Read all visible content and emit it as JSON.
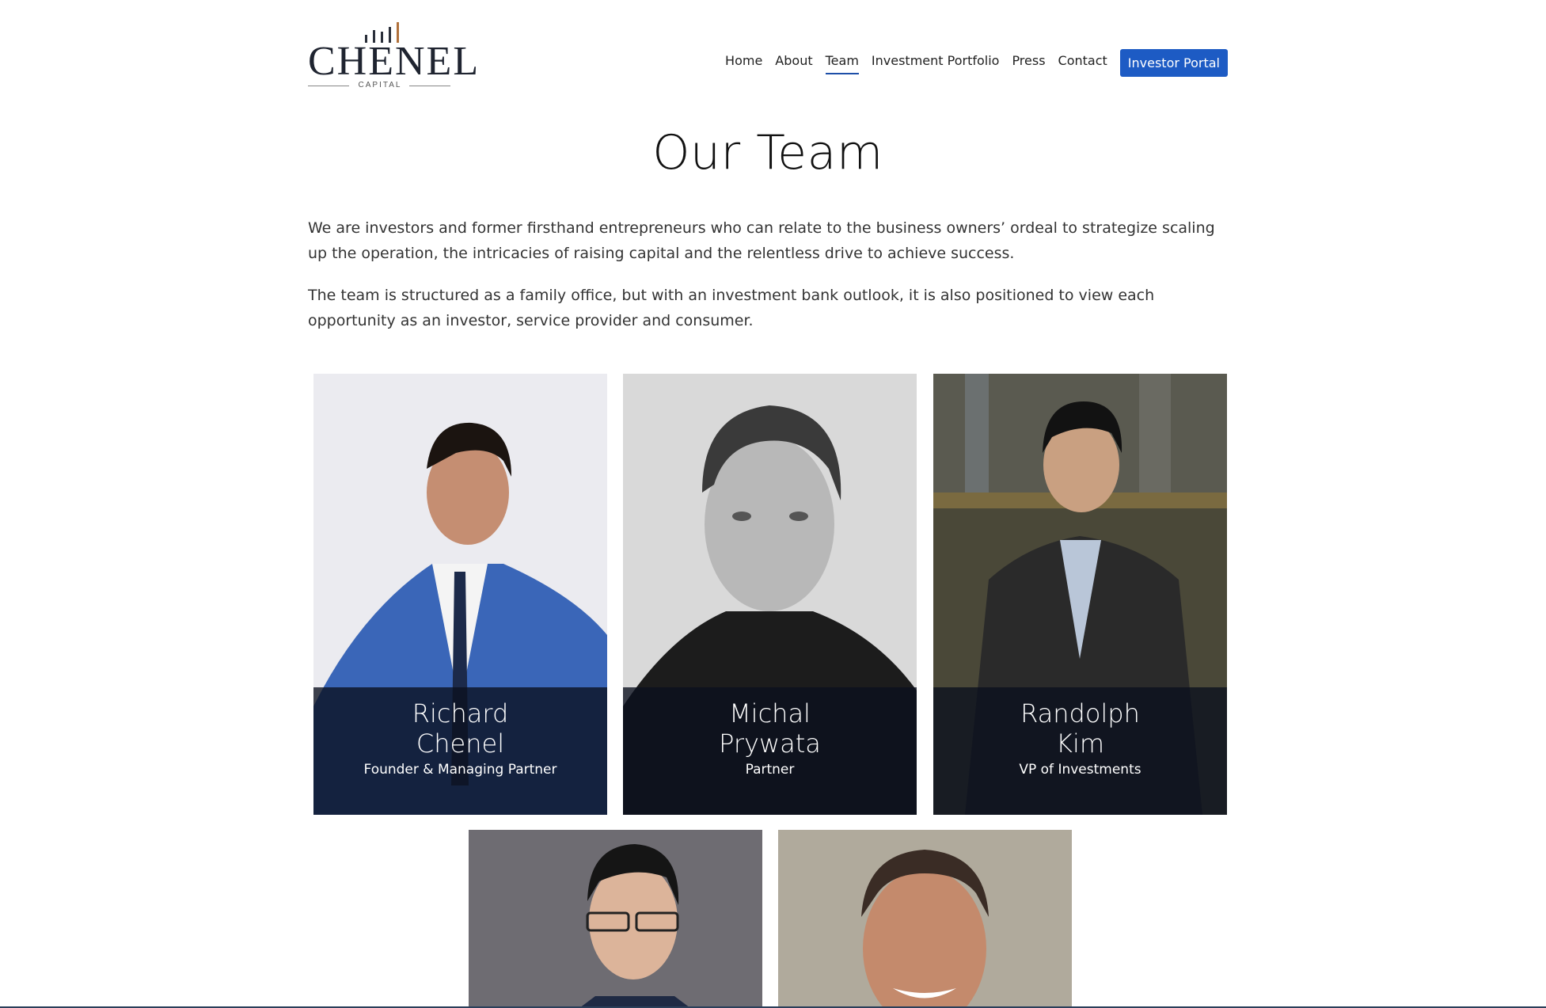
{
  "brand": {
    "name": "CHENEL",
    "tagline": "CAPITAL"
  },
  "nav": {
    "items": [
      {
        "label": "Home"
      },
      {
        "label": "About"
      },
      {
        "label": "Team"
      },
      {
        "label": "Investment Portfolio"
      },
      {
        "label": "Press"
      },
      {
        "label": "Contact"
      }
    ],
    "active": "Team",
    "portal_label": "Investor Portal"
  },
  "page": {
    "title": "Our Team",
    "paragraphs": [
      "We are investors and former firsthand entrepreneurs who can relate to the business owners’ ordeal to strategize scaling up the operation, the intricacies of raising capital and the relentless drive to achieve success.",
      "The team is structured as a family office, but with an investment bank outlook, it is also positioned to view each opportunity as an investor, service provider and consumer."
    ]
  },
  "team": [
    {
      "first": "Richard",
      "last": "Chenel",
      "role": "Founder & Managing Partner"
    },
    {
      "first": "Michal",
      "last": "Prywata",
      "role": "Partner"
    },
    {
      "first": "Randolph",
      "last": "Kim",
      "role": "VP of Investments"
    },
    {
      "first": "",
      "last": "",
      "role": ""
    },
    {
      "first": "",
      "last": "",
      "role": ""
    }
  ],
  "colors": {
    "accent": "#1d5bc4",
    "underline": "#1d4fa8",
    "overlay": "#0a101e"
  }
}
